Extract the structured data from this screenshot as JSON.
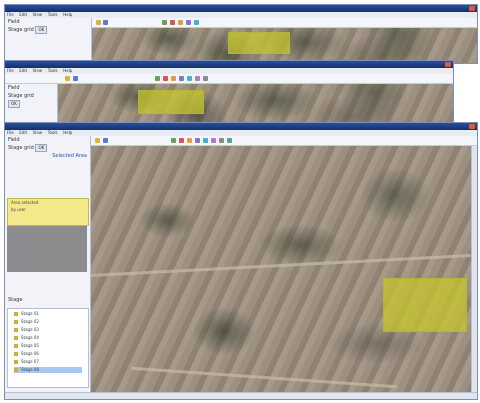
{
  "windows": [
    {
      "title": "",
      "menu": [
        "File",
        "Edit",
        "View",
        "Tools",
        "Help"
      ],
      "panel": {
        "label_top": "Field",
        "label_mid": "Stage grid",
        "button": "OK"
      }
    },
    {
      "title": "",
      "menu": [
        "File",
        "Edit",
        "View",
        "Tools",
        "Help"
      ],
      "panel": {
        "label_top": "Field",
        "label_mid": "Stage grid",
        "button": "OK"
      }
    },
    {
      "title": "",
      "menu": [
        "File",
        "Edit",
        "View",
        "Tools",
        "Help"
      ],
      "panel": {
        "label_top": "Field",
        "label_mid": "Stage grid",
        "button": "OK",
        "sub_label": "Selected Area",
        "info_lines": [
          "Area selected",
          "by user"
        ],
        "tree_header": "Stage",
        "tree_items": [
          "Stage 01",
          "Stage 02",
          "Stage 03",
          "Stage 04",
          "Stage 05",
          "Stage 06",
          "Stage 07",
          "Stage 08"
        ],
        "selected_index": 7
      }
    }
  ],
  "colors": {
    "titlebar": "#1f3f84",
    "field_highlight": "#c8c828",
    "selection": "#a8c9ee"
  },
  "icons": [
    "folder-icon",
    "save-icon",
    "zoom-in-icon",
    "zoom-out-icon",
    "pan-icon",
    "layer-icon",
    "select-icon",
    "info-icon",
    "ruler-icon",
    "print-icon"
  ]
}
